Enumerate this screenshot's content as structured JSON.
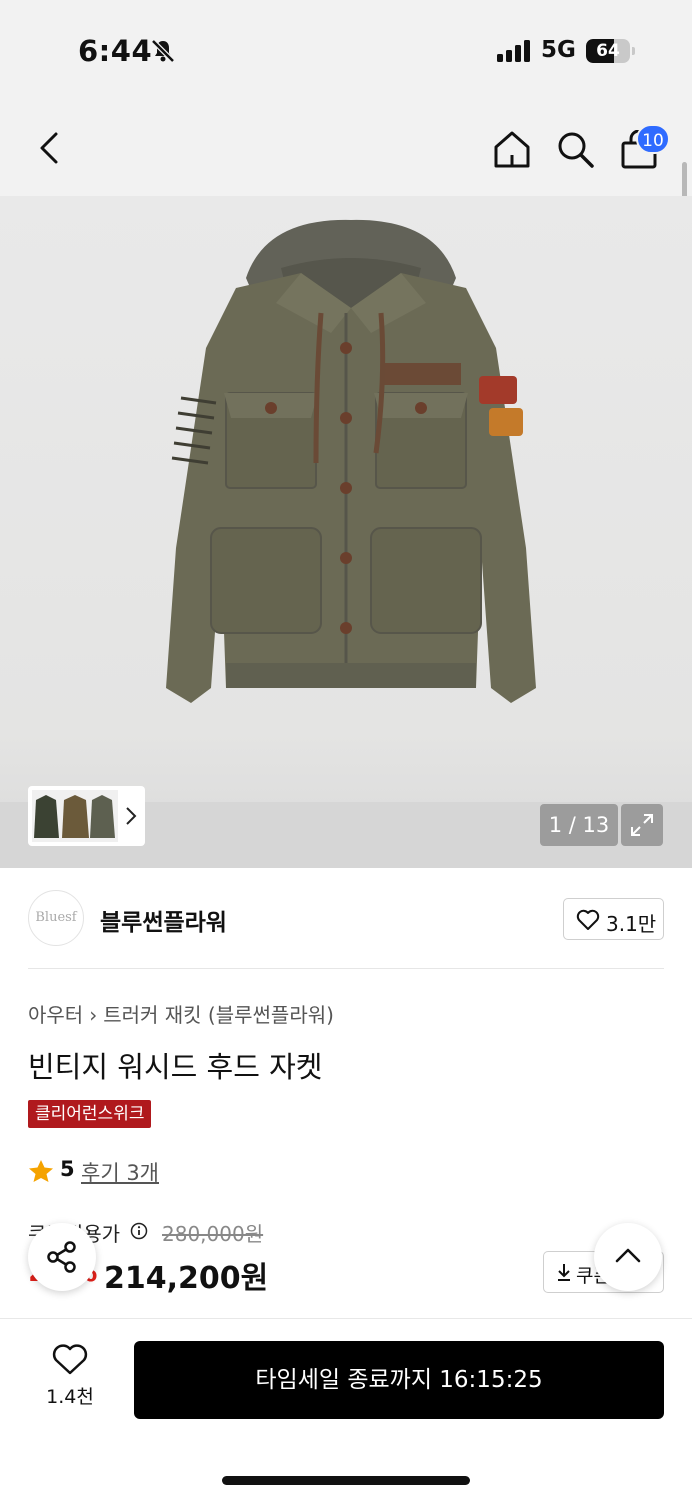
{
  "status_bar": {
    "time": "6:44",
    "network": "5G",
    "battery": 64
  },
  "header": {
    "cart_count": "10"
  },
  "gallery": {
    "counter": "1 / 13"
  },
  "brand": {
    "logo_text": "Bluesf",
    "name": "블루썬플라워",
    "likes": "3.1만"
  },
  "breadcrumb": {
    "category": "아우터",
    "sub": "트러커 재킷 (블루썬플라워)"
  },
  "product": {
    "title": "빈티지 워시드 후드 자켓",
    "tag": "클리어런스위크",
    "rating": "5",
    "reviews": "후기 3개",
    "coupon_label": "쿠폰적용가",
    "original_price": "280,000원",
    "discount": "23%",
    "price": "214,200원",
    "coupon_button": "쿠폰"
  },
  "bottom": {
    "wish_count": "1.4천",
    "cta": "타임세일 종료까지 16:15:25"
  },
  "colors": {
    "accent_red": "#b0191d",
    "badge_blue": "#2f6bff",
    "jacket": "#6b6a55"
  }
}
